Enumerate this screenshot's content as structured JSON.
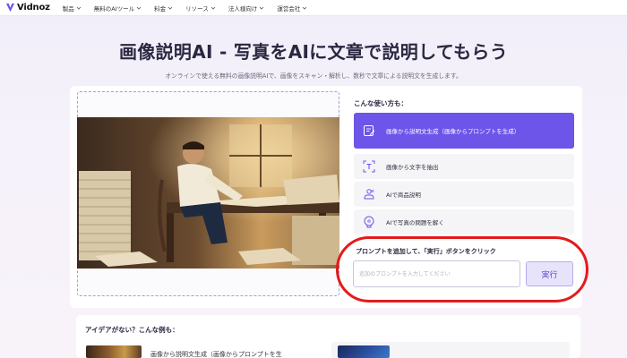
{
  "nav": {
    "brand": "Vidnoz",
    "items": [
      {
        "label": "製品"
      },
      {
        "label": "無料のAIツール"
      },
      {
        "label": "料金"
      },
      {
        "label": "リソース"
      },
      {
        "label": "法人様向け"
      },
      {
        "label": "運営会社"
      }
    ]
  },
  "hero": {
    "title": "画像説明AI - 写真をAIに文章で説明してもらう",
    "subtitle": "オンラインで使える無料の画像説明AIで、画像をスキャン・解析し、数秒で文章による説明文を生成します。"
  },
  "usage": {
    "label": "こんな使い方も：",
    "options": [
      {
        "label": "画像から説明文生成（画像からプロンプトを生成）",
        "icon": "edit-note-icon",
        "active": true
      },
      {
        "label": "画像から文字を抽出",
        "icon": "text-scan-icon",
        "active": false
      },
      {
        "label": "AIで商品説明",
        "icon": "product-icon",
        "active": false
      },
      {
        "label": "AIで写真の問題を解く",
        "icon": "brain-icon",
        "active": false
      }
    ]
  },
  "prompt": {
    "label": "プロンプトを追加して、「実行」ボタンをクリック",
    "placeholder": "追加のプロンプトを入力してください",
    "value": "",
    "run_label": "実行"
  },
  "ideas": {
    "label": "アイデアがない？こんな例も：",
    "item1_text": "画像から説明文生成（画像からプロンプトを生"
  },
  "colors": {
    "accent": "#6c55e8",
    "highlight": "#e31b1b",
    "title": "#2a2840"
  }
}
